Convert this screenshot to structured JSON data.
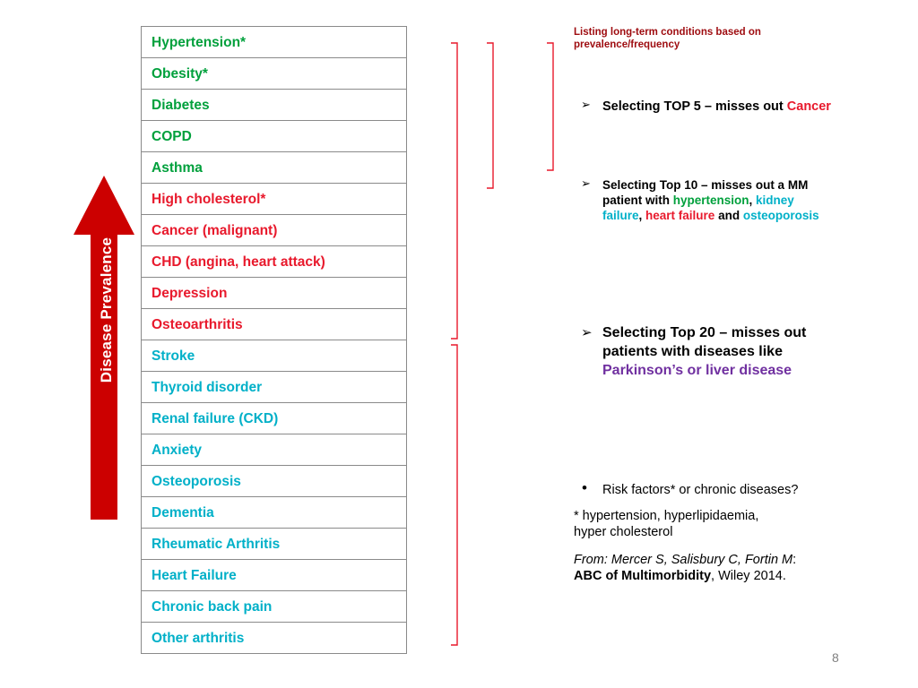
{
  "axis": {
    "label": "Disease Prevalence",
    "arrow_color": "#cc0000",
    "direction": "up"
  },
  "conditions": [
    {
      "label": "Hypertension*",
      "color": "#00a03c"
    },
    {
      "label": "Obesity*",
      "color": "#00a03c"
    },
    {
      "label": "Diabetes",
      "color": "#00a03c"
    },
    {
      "label": "COPD",
      "color": "#00a03c"
    },
    {
      "label": "Asthma",
      "color": "#00a03c"
    },
    {
      "label": "High cholesterol*",
      "color": "#e8192c"
    },
    {
      "label": "Cancer (malignant)",
      "color": "#e8192c"
    },
    {
      "label": "CHD (angina, heart attack)",
      "color": "#e8192c"
    },
    {
      "label": "Depression",
      "color": "#e8192c"
    },
    {
      "label": "Osteoarthritis",
      "color": "#e8192c"
    },
    {
      "label": "Stroke",
      "color": "#00b0c8"
    },
    {
      "label": "Thyroid disorder",
      "color": "#00b0c8"
    },
    {
      "label": "Renal failure (CKD)",
      "color": "#00b0c8"
    },
    {
      "label": "Anxiety",
      "color": "#00b0c8"
    },
    {
      "label": "Osteoporosis",
      "color": "#00b0c8"
    },
    {
      "label": "Dementia",
      "color": "#00b0c8"
    },
    {
      "label": "Rheumatic Arthritis",
      "color": "#00b0c8"
    },
    {
      "label": "Heart Failure",
      "color": "#00b0c8"
    },
    {
      "label": "Chronic back pain",
      "color": "#00b0c8"
    },
    {
      "label": "Other arthritis",
      "color": "#00b0c8"
    }
  ],
  "notes": {
    "title_line1": "Listing long-term conditions based on",
    "title_line2": "prevalence/frequency",
    "bullet1": {
      "marker": "➢",
      "text_before": "Selecting TOP 5 – misses out ",
      "highlight": "Cancer"
    },
    "bullet2": {
      "marker": "➢",
      "line1": "Selecting Top 10 – misses out a MM",
      "line2_before": "patient with ",
      "line2_hypertension": "hypertension",
      "line2_comma": ", ",
      "line2_kidney": "kidney",
      "line3_failure": "failure",
      "line3_comma": ", ",
      "line3_heart": "heart failure",
      "line3_and": " and ",
      "line3_osteo": "osteoporosis"
    },
    "bullet3": {
      "marker": "➢",
      "line1": "Selecting Top 20 – misses out",
      "line2": "patients with diseases like",
      "line3": "Parkinson’s or liver disease"
    },
    "bullet4": {
      "marker": "•",
      "text": "Risk factors* or chronic diseases?"
    },
    "footnote_line1": "* hypertension, hyperlipidaemia,",
    "footnote_line2": "hyper cholesterol",
    "source_italic": "From: Mercer S, Salisbury C, Fortin M",
    "source_colon": ":",
    "source_bold": "ABC of Multimorbidity",
    "source_rest": ", Wiley 2014."
  },
  "page_number": "8"
}
